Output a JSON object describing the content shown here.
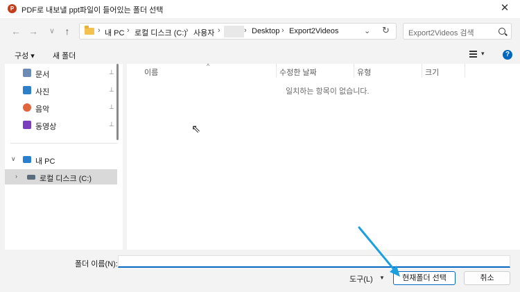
{
  "window": {
    "title": "PDF로 내보낼 ppt파일이 들어있는 폴더 선택",
    "app_icon": "P",
    "close_glyph": "✕"
  },
  "nav": {
    "back_glyph": "←",
    "forward_glyph": "→",
    "recent_glyph": "∨",
    "up_glyph": "↑",
    "breadcrumbs": [
      "내 PC",
      "로컬 디스크 (C:)",
      "사용자",
      "",
      "Desktop",
      "Export2Videos"
    ],
    "chevron_glyph": "›",
    "dropdown_glyph": "⌄",
    "refresh_glyph": "↻",
    "search_placeholder": "Export2Videos 검색"
  },
  "toolbar": {
    "organize_label": "구성 ▾",
    "new_folder_label": "새 폴더",
    "view_dropdown_glyph": "▾",
    "help_glyph": "?"
  },
  "sidebar": {
    "quick_access": [
      {
        "label": "문서",
        "icon": "documents-icon",
        "color": "#6d8bb7",
        "pin": "📌"
      },
      {
        "label": "사진",
        "icon": "pictures-icon",
        "color": "#2d7fc9",
        "pin": "📌"
      },
      {
        "label": "음악",
        "icon": "music-icon",
        "color": "#e0643c",
        "pin": "📌"
      },
      {
        "label": "동영상",
        "icon": "videos-icon",
        "color": "#7a3fbf",
        "pin": "📌"
      }
    ],
    "this_pc": {
      "label": "내 PC",
      "expand_glyph": "∨",
      "icon_color": "#2b7fd1"
    },
    "local_disk": {
      "label": "로컬 디스크 (C:)",
      "expand_glyph": "›"
    }
  },
  "columns": {
    "name": "이름",
    "modified": "수정한 날짜",
    "type": "유형",
    "size": "크기",
    "sort_glyph": "^"
  },
  "file_list": {
    "empty_message": "일치하는 항목이 없습니다."
  },
  "footer": {
    "folder_name_label": "폴더 이름(N):",
    "folder_name_value": "",
    "tools_label": "도구(L)",
    "tools_dropdown_glyph": "▼",
    "select_folder_label": "현재폴더 선택",
    "cancel_label": "취소"
  },
  "colors": {
    "accent": "#0067c0",
    "annotation_arrow": "#1aa0e0"
  }
}
